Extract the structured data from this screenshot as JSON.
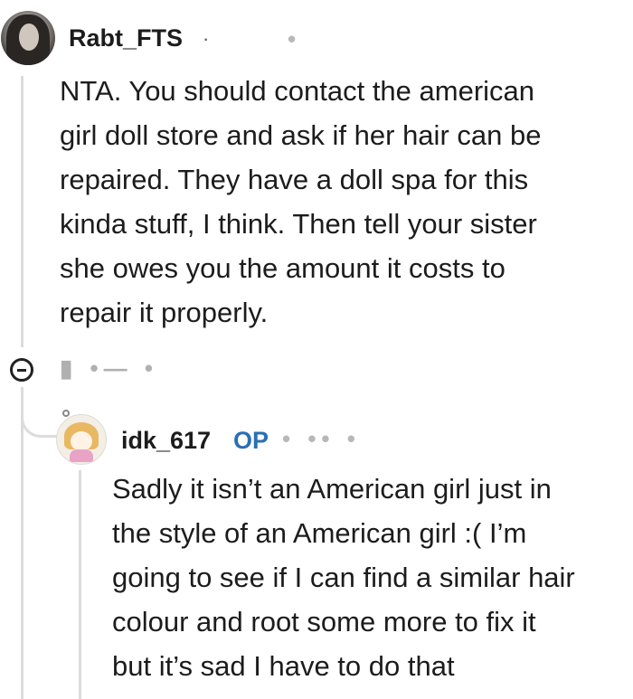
{
  "comment1": {
    "username": "Rabt_FTS",
    "meta": "·",
    "meta_blur": "•",
    "lines": [
      "NTA. You should contact the american",
      "girl doll store and ask if her hair can be",
      "repaired. They have a doll spa for this",
      "kinda stuff, I think. Then tell your sister",
      "she owes you the amount it costs to",
      "repair it properly."
    ],
    "actions_blur": "▮ •— •"
  },
  "reply1": {
    "username": "idk_617",
    "badge": "OP",
    "meta_blur": "• •• •",
    "lines": [
      "Sadly it isn’t an American girl just in",
      "the style of an American girl :( I’m",
      "going to see if I can find a similar hair",
      "colour and root some more to fix it",
      "but it’s sad I have to do that"
    ]
  }
}
